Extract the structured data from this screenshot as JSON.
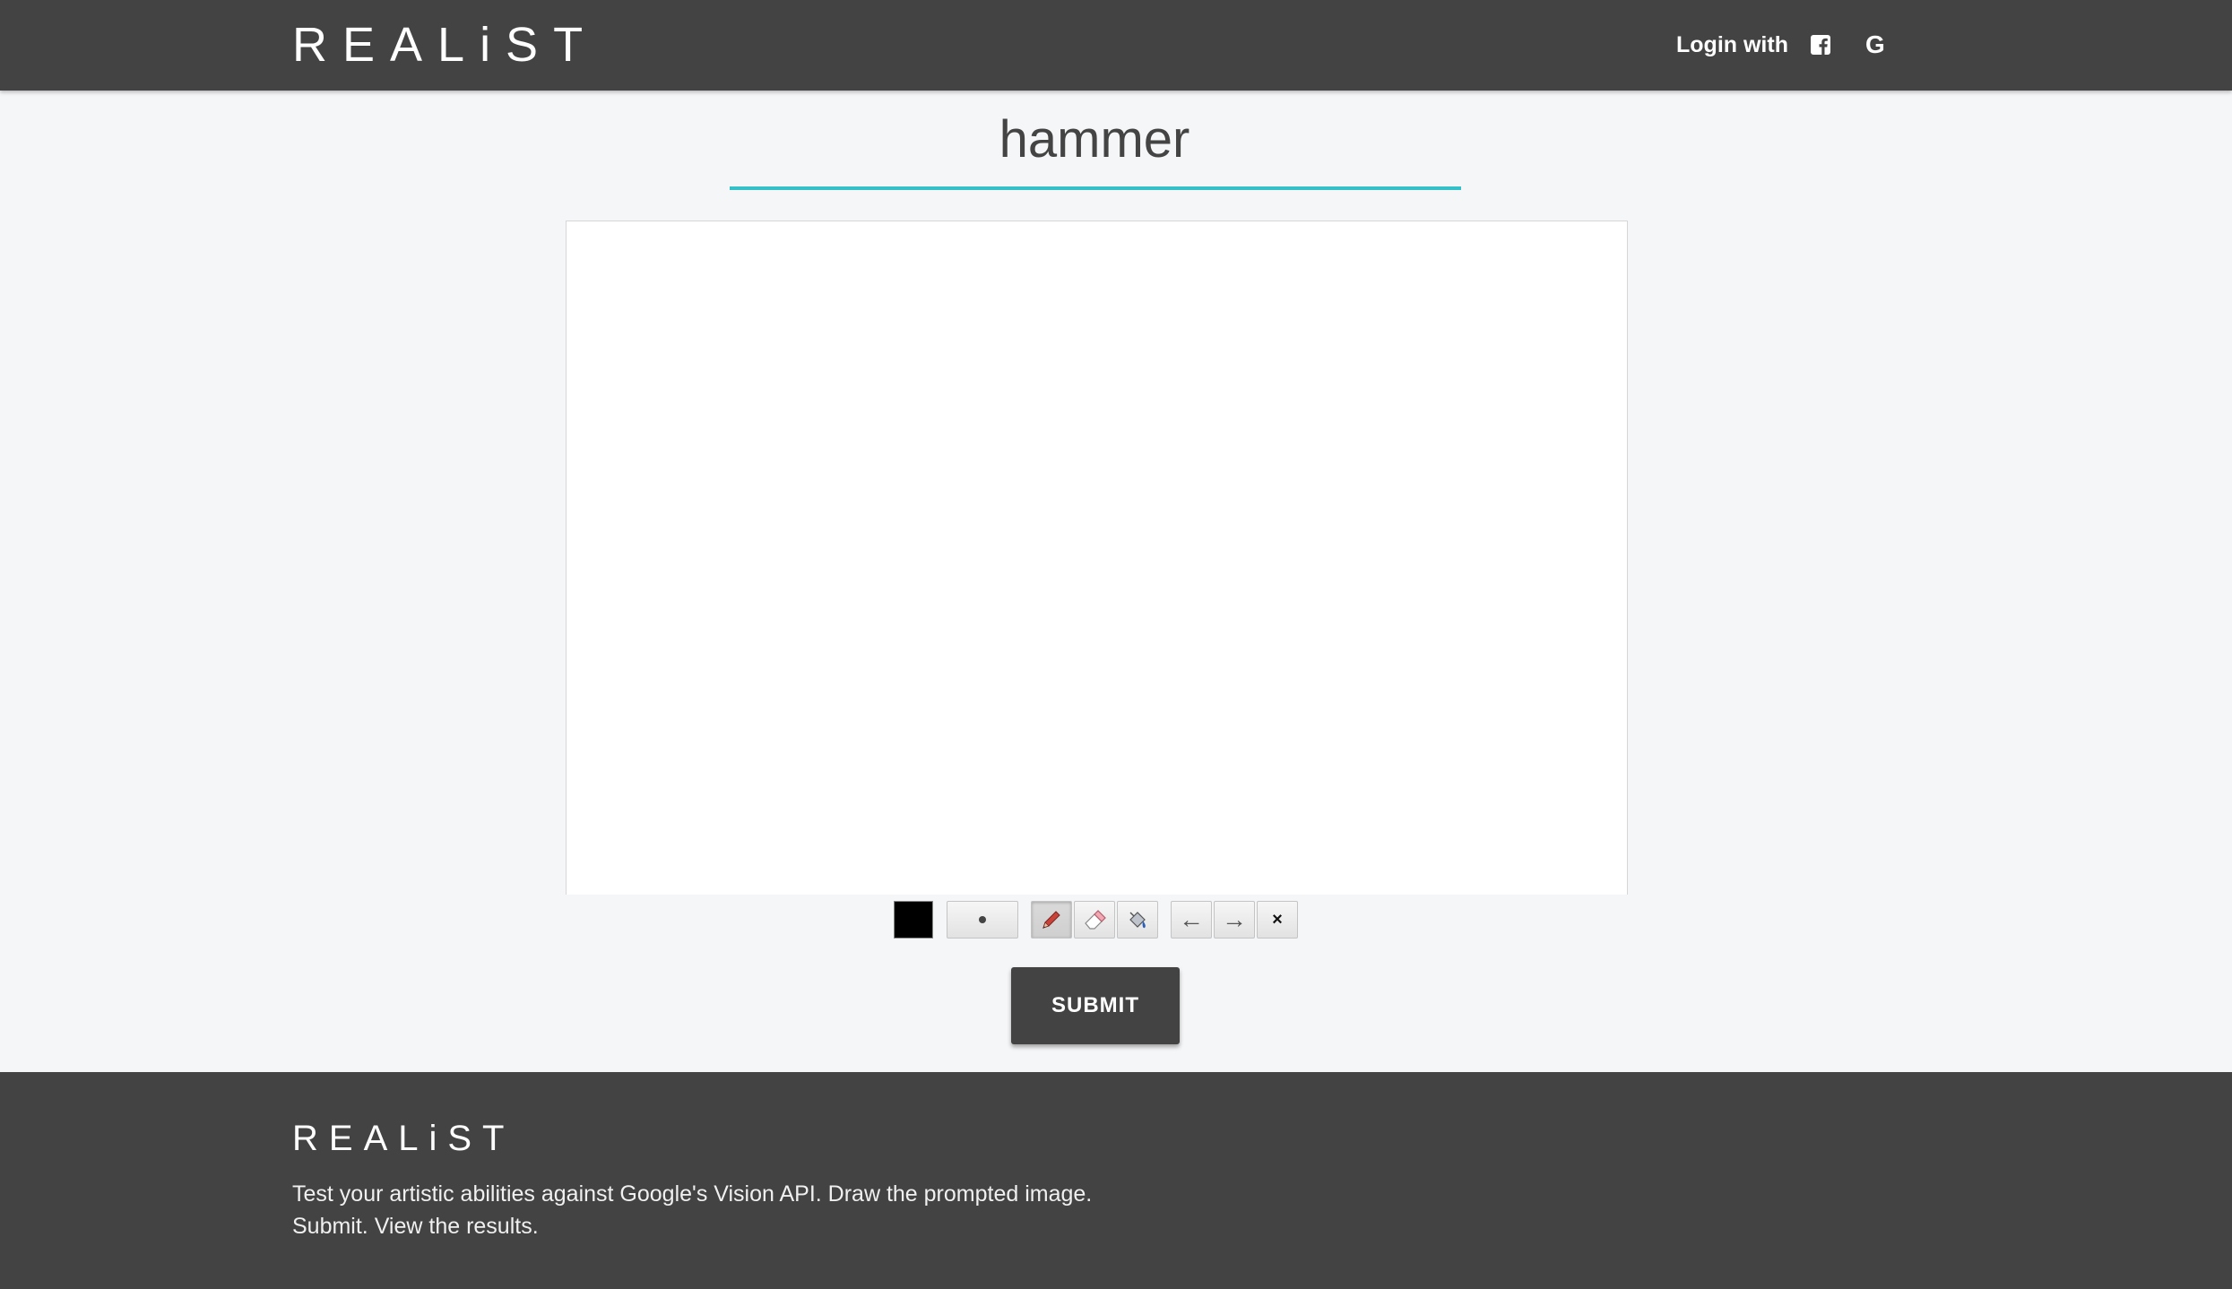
{
  "header": {
    "logo": "REALiST",
    "login_label": "Login with",
    "facebook_icon": "facebook-square-icon",
    "google_label": "G"
  },
  "main": {
    "prompt_word": "hammer",
    "accent_color": "#35c0c9"
  },
  "toolbar": {
    "current_color": "#000000",
    "tools": [
      {
        "name": "brush-size",
        "icon": "dot-icon"
      },
      {
        "name": "pencil",
        "icon": "pencil-icon",
        "active": true
      },
      {
        "name": "eraser",
        "icon": "eraser-icon"
      },
      {
        "name": "fill",
        "icon": "paint-bucket-icon"
      },
      {
        "name": "undo",
        "icon": "left-arrow-icon",
        "glyph": "←"
      },
      {
        "name": "redo",
        "icon": "right-arrow-icon",
        "glyph": "→"
      },
      {
        "name": "clear",
        "icon": "close-icon",
        "glyph": "×"
      }
    ],
    "submit_label": "SUBMIT"
  },
  "footer": {
    "logo": "REALiST",
    "description_line1": "Test your artistic abilities against Google's Vision API. Draw the prompted image.",
    "description_line2": "Submit. View the results."
  }
}
